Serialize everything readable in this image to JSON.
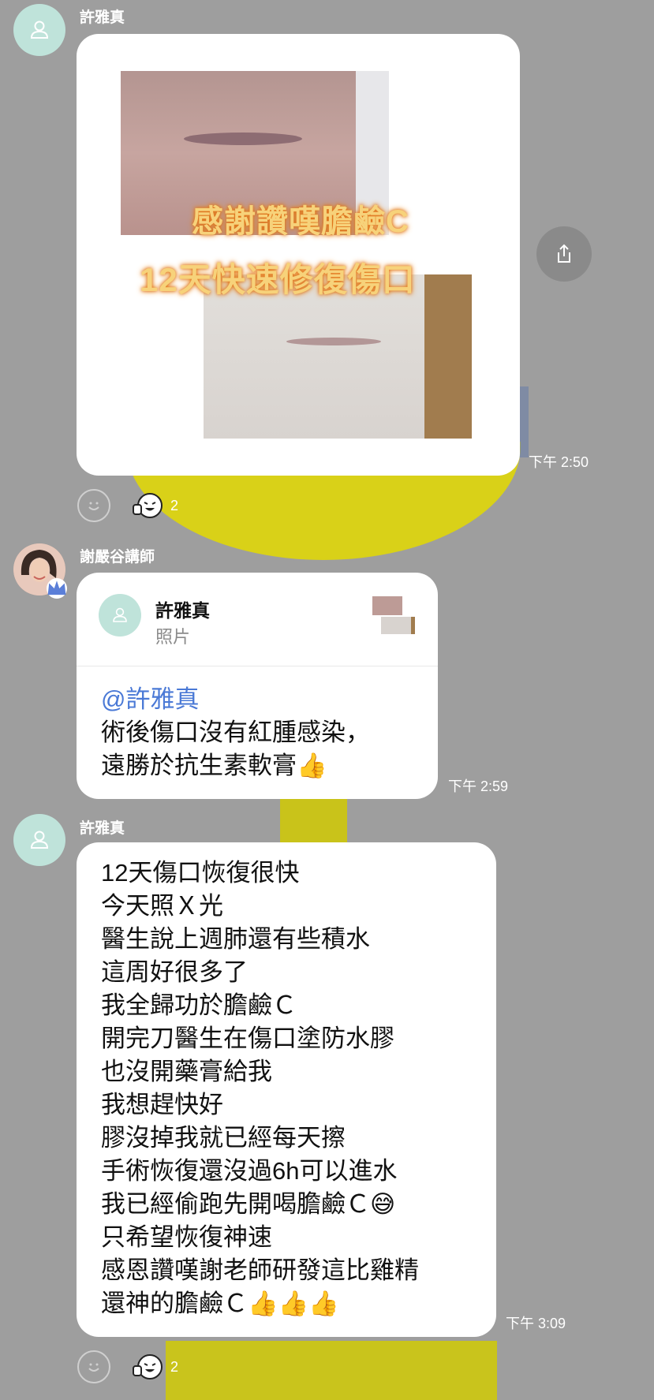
{
  "messages": [
    {
      "sender": "許雅真",
      "type": "photo",
      "photo_caption_1": "感謝讚嘆膽鹼C",
      "photo_caption_2": "12天快速修復傷口",
      "time": "下午 2:50",
      "reaction_count": "2"
    },
    {
      "sender": "謝嚴谷講師",
      "type": "reply",
      "quote_name": "許雅真",
      "quote_type": "照片",
      "mention": "@許雅真",
      "lines": [
        "術後傷口沒有紅腫感染，",
        "遠勝於抗生素軟膏👍"
      ],
      "time": "下午 2:59"
    },
    {
      "sender": "許雅真",
      "type": "text",
      "lines": [
        "12天傷口恢復很快",
        "今天照Ｘ光",
        "醫生說上週肺還有些積水",
        "這周好很多了",
        "我全歸功於膽鹼Ｃ",
        "開完刀醫生在傷口塗防水膠",
        "也沒開藥膏給我",
        "我想趕快好",
        "膠沒掉我就已經每天擦",
        "手術恢復還沒過6h可以進水",
        "我已經偷跑先開喝膽鹼Ｃ😅",
        "只希望恢復神速",
        "感恩讚嘆謝老師研發這比雞精",
        "還神的膽鹼Ｃ👍👍👍"
      ],
      "time": "下午 3:09",
      "reaction_count": "2"
    }
  ],
  "icons": {
    "share": "share-icon",
    "smiley": "add-reaction-icon",
    "reaction": "laughing-thumbs-up-sticker",
    "avatar_default": "user-placeholder-icon",
    "admin_badge": "crown-icon"
  },
  "colors": {
    "mention": "#4a79d6",
    "avatar_bg": "#bfe3da",
    "bubble": "#ffffff",
    "background": "#9e9e9e"
  }
}
